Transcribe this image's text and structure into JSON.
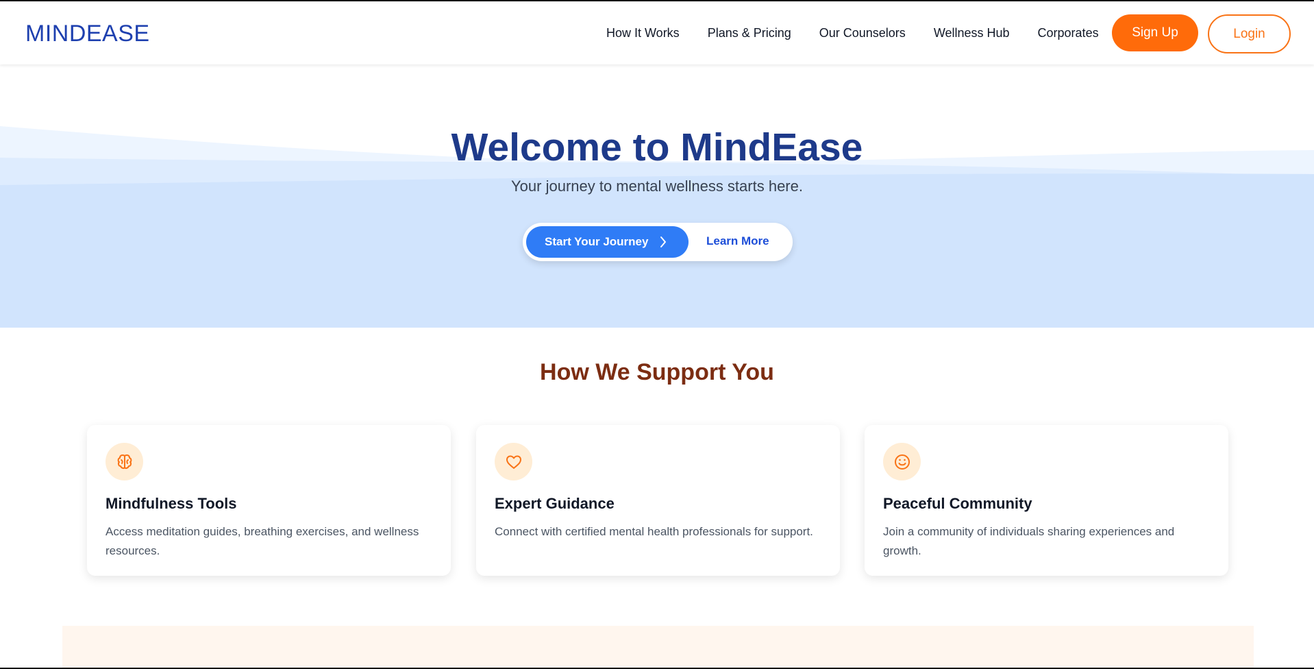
{
  "brand": {
    "logo": "MINDEASE"
  },
  "nav": {
    "links": [
      "How It Works",
      "Plans & Pricing",
      "Our Counselors",
      "Wellness Hub",
      "Corporates"
    ],
    "signup_label": "Sign Up",
    "login_label": "Login"
  },
  "hero": {
    "title": "Welcome to MindEase",
    "subtitle": "Your journey to mental wellness starts here.",
    "primary_cta": "Start Your Journey",
    "secondary_cta": "Learn More"
  },
  "support": {
    "title": "How We Support You",
    "cards": [
      {
        "icon": "brain-icon",
        "title": "Mindfulness Tools",
        "description": "Access meditation guides, breathing exercises, and wellness resources."
      },
      {
        "icon": "heart-icon",
        "title": "Expert Guidance",
        "description": "Connect with certified mental health professionals for support."
      },
      {
        "icon": "smile-icon",
        "title": "Peaceful Community",
        "description": "Join a community of individuals sharing experiences and growth."
      }
    ]
  },
  "colors": {
    "brand_blue": "#1e40af",
    "accent_orange": "#ff6b0a",
    "hero_blue": "#d1e4fd",
    "cta_blue": "#2f7cf6",
    "section_title": "#7c2d12",
    "icon_bg": "#ffedd5"
  }
}
